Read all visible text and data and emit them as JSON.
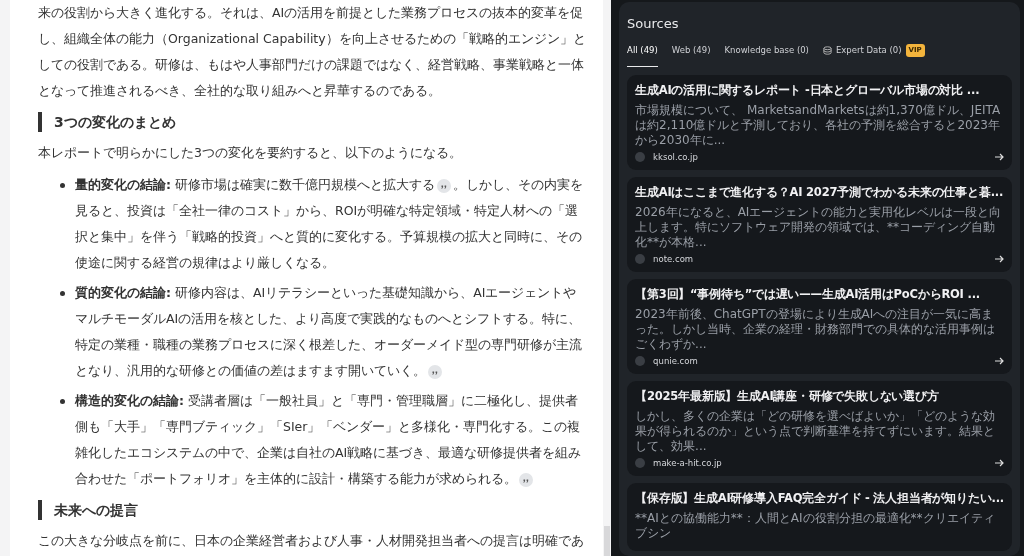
{
  "article": {
    "blocks": [
      {
        "kind": "paragraph",
        "text": "来の役割から大きく進化する。それは、AIの活用を前提とした業務プロセスの抜本的変革を促し、組織全体の能力（Organizational Capability）を向上させるための「戦略的エンジン」としての役割である。研修は、もはや人事部門だけの課題ではなく、経営戦略、事業戦略と一体となって推進されるべき、全社的な取り組みへと昇華するのである。"
      },
      {
        "kind": "heading",
        "text": "3つの変化のまとめ"
      },
      {
        "kind": "paragraph",
        "text": "本レポートで明らかにした3つの変化を要約すると、以下のようになる。"
      },
      {
        "kind": "bullets",
        "items": [
          {
            "text": "**量的変化の結論:** 研修市場は確実に数千億円規模へと拡大する",
            "cited": true,
            "rest": "。しかし、その内実を見ると、投資は「全社一律のコスト」から、ROIが明確な特定領域・特定人材への「選択と集中」を伴う「戦略的投資」へと質的に変化する。予算規模の拡大と同時に、その使途に関する経営の規律はより厳しくなる。"
          },
          {
            "text": "**質的変化の結論:** 研修内容は、AIリテラシーといった基礎知識から、AIエージェントやマルチモーダルAIの活用を核とした、より高度で実践的なものへとシフトする。特に、特定の業種・職種の業務プロセスに深く根差した、オーダーメイド型の専門研修が主流となり、汎用的な研修との価値の差はますます開いていく。",
            "cited": true
          },
          {
            "text": "**構造的変化の結論:** 受講者層は「一般社員」と「専門・管理職層」に二極化し、提供者側も「大手」「専門ブティック」「SIer」「ベンダー」と多様化・専門化する。この複雑化したエコシステムの中で、企業は自社のAI戦略に基づき、最適な研修提供者を組み合わせた「ポートフォリオ」を主体的に設計・構築する能力が求められる。",
            "cited": true
          }
        ]
      },
      {
        "kind": "heading",
        "text": "未来への提言"
      },
      {
        "kind": "paragraph",
        "text": "この大きな分岐点を前に、日本の企業経営者および人事・人材開発担当者への提言は明確であ"
      }
    ]
  },
  "sources": {
    "title": "Sources",
    "tabs": [
      {
        "kind": "plain",
        "label": "All (49)",
        "selected": true
      },
      {
        "kind": "plain",
        "label": "Web (49)",
        "selected": false
      },
      {
        "kind": "plain",
        "label": "Knowledge base (0)",
        "selected": false
      },
      {
        "kind": "expert",
        "label": "Expert Data (0)",
        "selected": false,
        "badge": "VIP"
      }
    ],
    "cards": [
      {
        "title": "生成AIの活用に関するレポート -日本とグローバル市場の対比 ...",
        "snippet": "市場規模について、 MarketsandMarketsは約1,370億ドル、JEITAは約2,110億ドルと予測しており、各社の予測を総合すると2023年から2030年に...",
        "domain": "kksol.co.jp"
      },
      {
        "title": "生成AIはここまで進化する？AI 2027予測でわかる未来の仕事と暮...",
        "snippet": "2026年になると、AIエージェントの能力と実用化レベルは一段と向上します。特にソフトウェア開発の領域では、**コーディング自動化**が本格...",
        "domain": "note.com"
      },
      {
        "title": "【第3回】“事例待ち”では遅い——生成AI活用はPoCからROI ...",
        "snippet": "2023年前後、ChatGPTの登場により生成AIへの注目が一気に高まった。しかし当時、企業の経理・財務部門での具体的な活用事例はごくわずか...",
        "domain": "qunie.com"
      },
      {
        "title": "【2025年最新版】生成AI講座・研修で失敗しない選び方",
        "snippet": "しかし、多くの企業は「どの研修を選べばよいか」「どのような効果が得られるのか」という点で判断基準を持てずにいます。結果として、効果...",
        "domain": "make-a-hit.co.jp"
      },
      {
        "title": "【保存版】生成AI研修導入FAQ完全ガイド - 法人担当者が知りたい...",
        "snippet": "**AIとの協働能力**：人間とAIの役割分担の最適化**クリエイティブシン"
      }
    ]
  }
}
